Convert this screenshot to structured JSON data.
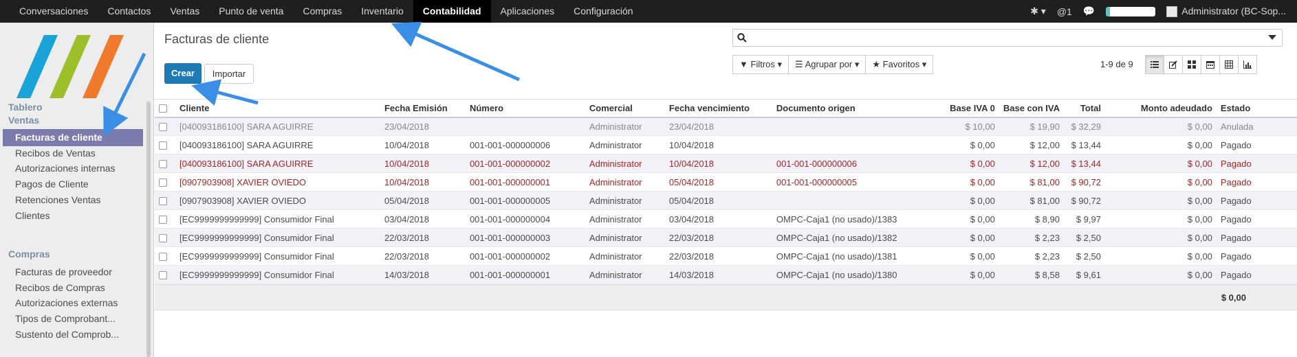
{
  "topnav": [
    "Conversaciones",
    "Contactos",
    "Ventas",
    "Punto de venta",
    "Compras",
    "Inventario",
    "Contabilidad",
    "Aplicaciones",
    "Configuración"
  ],
  "topright": {
    "notifications": "@1",
    "user": "Administrator (BC-Sop..."
  },
  "sidebar": {
    "group_tablero": "Tablero",
    "group_ventas": "Ventas",
    "ventas_items": [
      "Facturas de cliente",
      "Recibos de Ventas",
      "Autorizaciones internas",
      "Pagos de Cliente",
      "Retenciones Ventas",
      "Clientes"
    ],
    "group_compras": "Compras",
    "compras_items": [
      "Facturas de proveedor",
      "Recibos de Compras",
      "Autorizaciones externas",
      "Tipos de Comprobant...",
      "Sustento del Comprob..."
    ]
  },
  "page": {
    "title": "Facturas de cliente",
    "crear": "Crear",
    "importar": "Importar"
  },
  "search": {
    "filters": "Filtros",
    "group_by": "Agrupar por",
    "favorites": "Favoritos"
  },
  "pager": "1-9 de 9",
  "table": {
    "headers": [
      "Cliente",
      "Fecha Emisión",
      "Número",
      "Comercial",
      "Fecha vencimiento",
      "Documento origen",
      "Base IVA 0",
      "Base con IVA",
      "Total",
      "Monto adeudado",
      "Estado"
    ],
    "rows": [
      {
        "style": "grey",
        "cells": [
          "[040093186100] SARA AGUIRRE",
          "23/04/2018",
          "",
          "Administrator",
          "23/04/2018",
          "",
          "$ 10,00",
          "$ 19,90",
          "$ 32,29",
          "$ 0,00",
          "Anulada"
        ]
      },
      {
        "style": "",
        "cells": [
          "[040093186100] SARA AGUIRRE",
          "10/04/2018",
          "001-001-000000006",
          "Administrator",
          "10/04/2018",
          "",
          "$ 0,00",
          "$ 12,00",
          "$ 13,44",
          "$ 0,00",
          "Pagado"
        ]
      },
      {
        "style": "red",
        "cells": [
          "[040093186100] SARA AGUIRRE",
          "10/04/2018",
          "001-001-000000002",
          "Administrator",
          "10/04/2018",
          "001-001-000000006",
          "$ 0,00",
          "$ 12,00",
          "$ 13,44",
          "$ 0,00",
          "Pagado"
        ]
      },
      {
        "style": "red",
        "cells": [
          "[0907903908] XAVIER OVIEDO",
          "10/04/2018",
          "001-001-000000001",
          "Administrator",
          "05/04/2018",
          "001-001-000000005",
          "$ 0,00",
          "$ 81,00",
          "$ 90,72",
          "$ 0,00",
          "Pagado"
        ]
      },
      {
        "style": "",
        "cells": [
          "[0907903908] XAVIER OVIEDO",
          "05/04/2018",
          "001-001-000000005",
          "Administrator",
          "05/04/2018",
          "",
          "$ 0,00",
          "$ 81,00",
          "$ 90,72",
          "$ 0,00",
          "Pagado"
        ]
      },
      {
        "style": "",
        "cells": [
          "[EC9999999999999] Consumidor Final",
          "03/04/2018",
          "001-001-000000004",
          "Administrator",
          "03/04/2018",
          "OMPC-Caja1 (no usado)/1383",
          "$ 0,00",
          "$ 8,90",
          "$ 9,97",
          "$ 0,00",
          "Pagado"
        ]
      },
      {
        "style": "",
        "cells": [
          "[EC9999999999999] Consumidor Final",
          "22/03/2018",
          "001-001-000000003",
          "Administrator",
          "22/03/2018",
          "OMPC-Caja1 (no usado)/1382",
          "$ 0,00",
          "$ 2,23",
          "$ 2,50",
          "$ 0,00",
          "Pagado"
        ]
      },
      {
        "style": "",
        "cells": [
          "[EC9999999999999] Consumidor Final",
          "22/03/2018",
          "001-001-000000002",
          "Administrator",
          "22/03/2018",
          "OMPC-Caja1 (no usado)/1381",
          "$ 0,00",
          "$ 2,23",
          "$ 2,50",
          "$ 0,00",
          "Pagado"
        ]
      },
      {
        "style": "",
        "cells": [
          "[EC9999999999999] Consumidor Final",
          "14/03/2018",
          "001-001-000000001",
          "Administrator",
          "14/03/2018",
          "OMPC-Caja1 (no usado)/1380",
          "$ 0,00",
          "$ 8,58",
          "$ 9,61",
          "$ 0,00",
          "Pagado"
        ]
      }
    ],
    "footer_total": "$ 0,00"
  },
  "colors": {
    "primary": "#1f7bb5",
    "active_menu": "#7c7bad",
    "overdue": "#a52626",
    "arrow": "#3a8ee6"
  }
}
